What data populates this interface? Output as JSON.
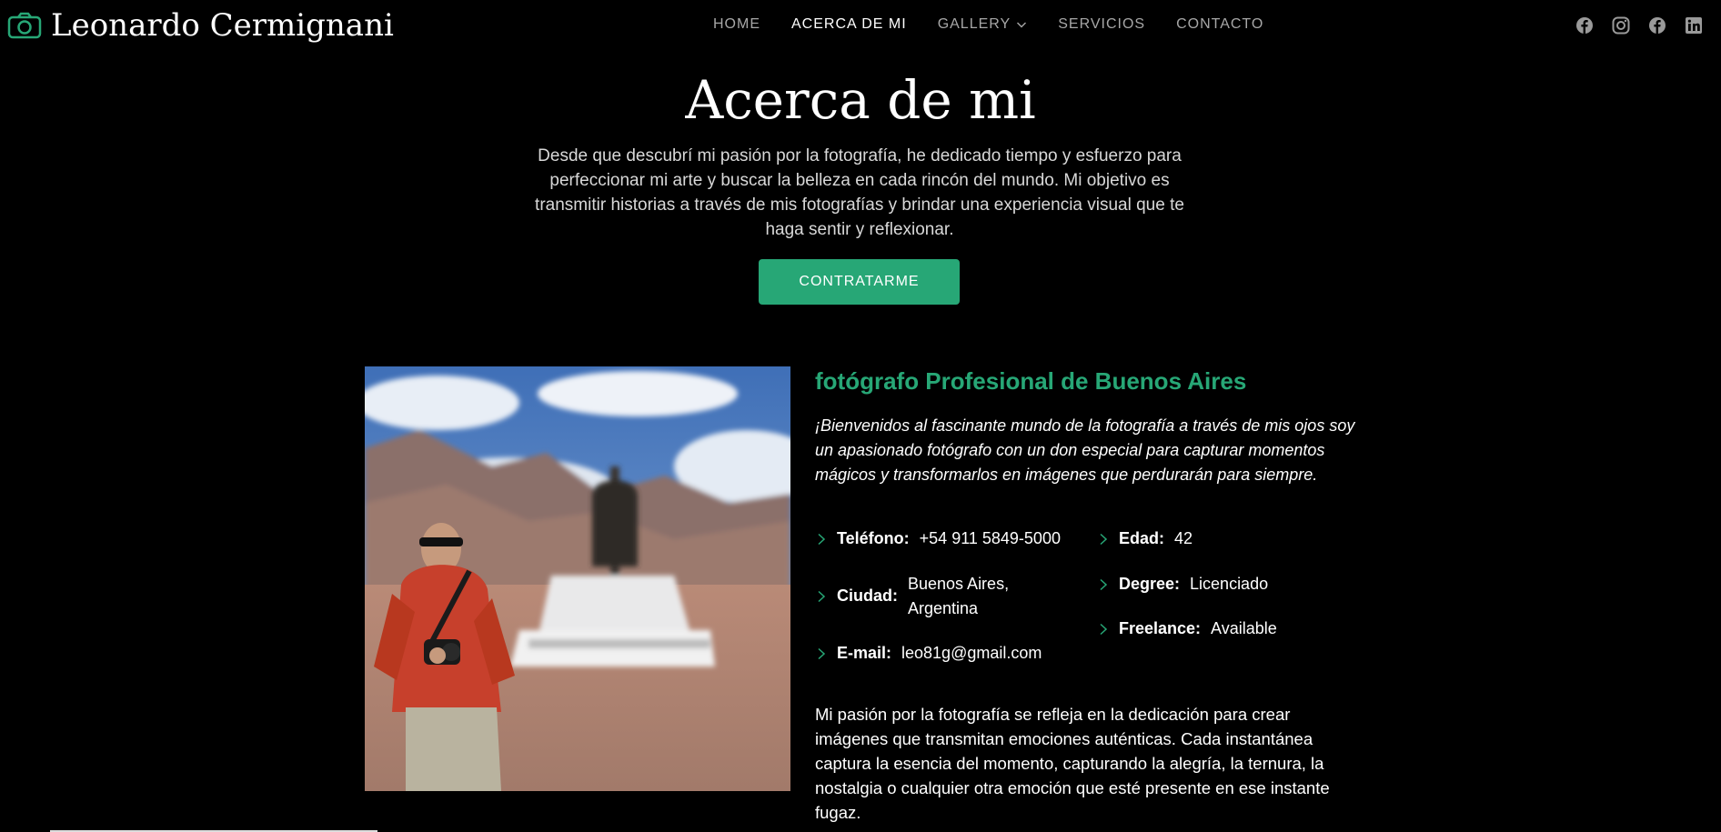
{
  "header": {
    "site_title": "Leonardo Cermignani",
    "nav": [
      {
        "label": "HOME",
        "active": false
      },
      {
        "label": "ACERCA DE MI",
        "active": true
      },
      {
        "label": "GALLERY",
        "active": false,
        "dropdown": true
      },
      {
        "label": "SERVICIOS",
        "active": false
      },
      {
        "label": "CONTACTO",
        "active": false
      }
    ],
    "social_icons": [
      "facebook-icon",
      "instagram-icon",
      "facebook-icon",
      "linkedin-icon"
    ]
  },
  "hero": {
    "title": "Acerca de mi",
    "description": "Desde que descubrí mi pasión por la fotografía, he dedicado tiempo y esfuerzo para perfeccionar mi arte y buscar la belleza en cada rincón del mundo. Mi objetivo es transmitir historias a través de mis fotografías y brindar una experiencia visual que te haga sentir y reflexionar.",
    "cta_label": "CONTRATARME"
  },
  "about": {
    "title": "fotógrafo Profesional de Buenos Aires",
    "intro": "¡Bienvenidos al fascinante mundo de la fotografía a través de mis ojos soy un apasionado fotógrafo con un don especial para capturar momentos mágicos y transformarlos en imágenes que perdurarán para siempre.",
    "details": {
      "phone_label": "Teléfono:",
      "phone_value": "+54 911 5849-5000",
      "city_label": "Ciudad:",
      "city_value_1": "Buenos Aires,",
      "city_value_2": "Argentina",
      "email_label": "E-mail:",
      "email_value": "leo81g@gmail.com",
      "age_label": "Edad:",
      "age_value": "42",
      "degree_label": "Degree:",
      "degree_value": "Licenciado",
      "freelance_label": "Freelance:",
      "freelance_value": "Available"
    },
    "paragraph": "Mi pasión por la fotografía se refleja en la dedicación para crear imágenes que transmitan emociones auténticas. Cada instantánea captura la esencia del momento, capturando la alegría, la ternura, la nostalgia o cualquier otra emoción que esté presente en ese instante fugaz."
  },
  "colors": {
    "accent": "#27a776",
    "background": "#000000",
    "nav_inactive": "#a7a7a7"
  }
}
